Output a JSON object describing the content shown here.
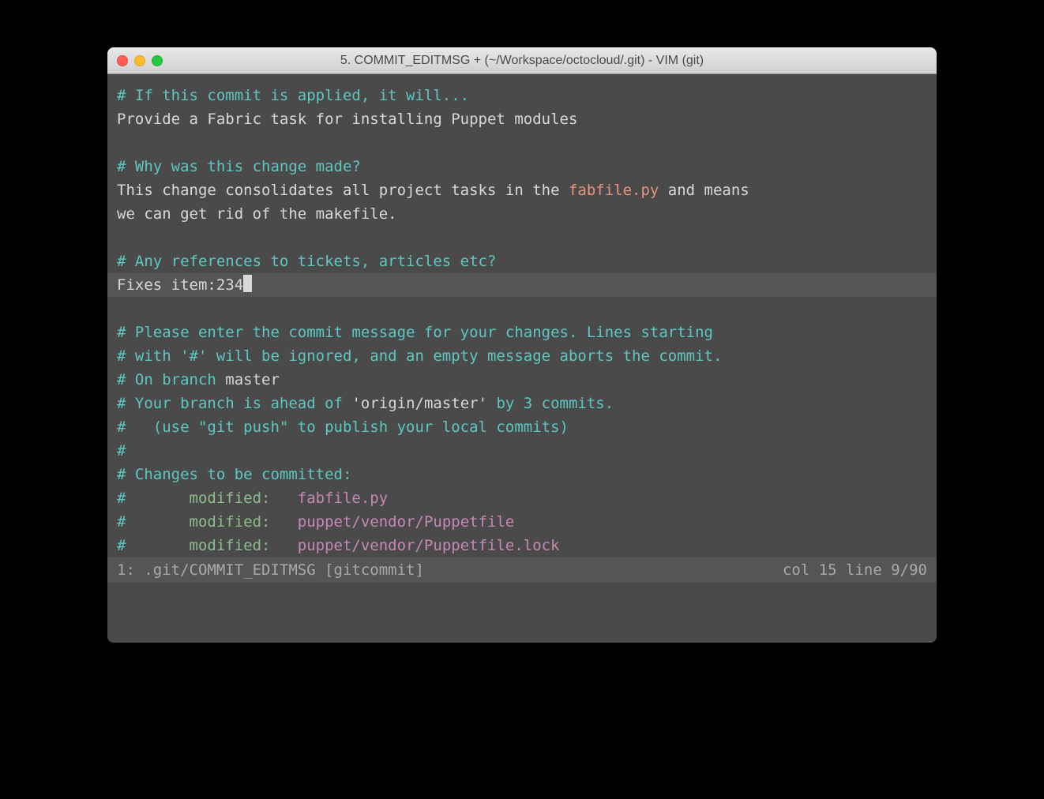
{
  "window": {
    "title": "5. COMMIT_EDITMSG + (~/Workspace/octocloud/.git) - VIM (git)"
  },
  "lines": {
    "l1_comment": "# If this commit is applied, it will...",
    "l2_text": "Provide a Fabric task for installing Puppet modules",
    "l4_comment": "# Why was this change made?",
    "l5_text_a": "This change consolidates all project tasks in the ",
    "l5_filename": "fabfile.py",
    "l5_text_b": " and means",
    "l6_text": "we can get rid of the makefile.",
    "l8_comment": "# Any references to tickets, articles etc?",
    "l9_text": "Fixes item:234",
    "l11_comment": "# Please enter the commit message for your changes. Lines starting",
    "l12_comment": "# with '#' will be ignored, and an empty message aborts the commit.",
    "l13_hash": "# ",
    "l13_a": "On branch ",
    "l13_branch": "master",
    "l14_hash": "# ",
    "l14_a": "Your branch is ahead of ",
    "l14_quoted": "'origin/master'",
    "l14_b": " by 3 commits.",
    "l15_comment": "#   (use \"git push\" to publish your local commits)",
    "l16_comment": "#",
    "l17_comment": "# Changes to be committed:",
    "l18_hash": "#",
    "l18_mod": "       modified:   ",
    "l18_file": "fabfile.py",
    "l19_hash": "#",
    "l19_mod": "       modified:   ",
    "l19_file": "puppet/vendor/Puppetfile",
    "l20_hash": "#",
    "l20_mod": "       modified:   ",
    "l20_file": "puppet/vendor/Puppetfile.lock"
  },
  "statusbar": {
    "left": "1: .git/COMMIT_EDITMSG [gitcommit]",
    "right": "col 15 line 9/90"
  }
}
